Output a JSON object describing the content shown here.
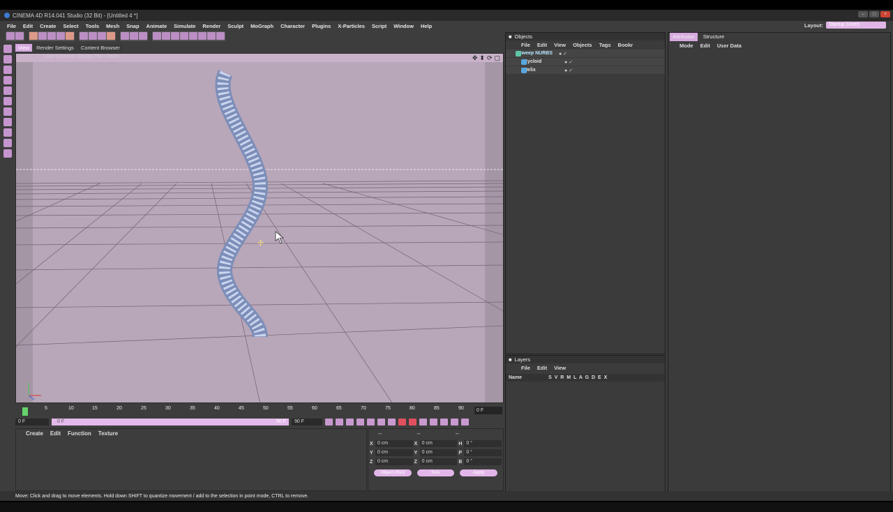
{
  "window": {
    "title": "CINEMA 4D R14.041 Studio (32 Bit) - [Untitled 4 *]"
  },
  "menubar": [
    "File",
    "Edit",
    "Create",
    "Select",
    "Tools",
    "Mesh",
    "Snap",
    "Animate",
    "Simulate",
    "Render",
    "Sculpt",
    "MoGraph",
    "Character",
    "Plugins",
    "X-Particles",
    "Script",
    "Window",
    "Help"
  ],
  "layout": {
    "label": "Layout:",
    "value": "Startup (User)"
  },
  "viewport": {
    "tabs": [
      "View",
      "Render Settings",
      "Content Browser"
    ],
    "menu_hint": "View Cameras Display Filter Panel"
  },
  "timeline": {
    "ticks": [
      "0",
      "5",
      "10",
      "15",
      "20",
      "25",
      "30",
      "35",
      "40",
      "45",
      "50",
      "55",
      "60",
      "65",
      "70",
      "75",
      "80",
      "85",
      "90"
    ],
    "current_frame": "0 F",
    "start_field": "0 F",
    "slider_start": "0 F",
    "slider_end": "90 F",
    "end_field": "90 F"
  },
  "materials": {
    "menu": [
      "Create",
      "Edit",
      "Function",
      "Texture"
    ]
  },
  "coordinates": {
    "headers": [
      "--",
      "--",
      "--"
    ],
    "rows": [
      {
        "a": "X",
        "av": "0 cm",
        "b": "X",
        "bv": "0 cm",
        "c": "H",
        "cv": "0 °"
      },
      {
        "a": "Y",
        "av": "0 cm",
        "b": "Y",
        "bv": "0 cm",
        "c": "P",
        "cv": "0 °"
      },
      {
        "a": "Z",
        "av": "0 cm",
        "b": "Z",
        "bv": "0 cm",
        "c": "B",
        "cv": "0 °"
      }
    ],
    "buttons": [
      "Object (Rel)",
      "Size",
      "Apply"
    ]
  },
  "objects_panel": {
    "title": "Objects",
    "menu": [
      "File",
      "Edit",
      "View",
      "Objects",
      "Tags",
      "Bookr"
    ],
    "items": [
      {
        "name": "Sweep NURBS",
        "color": "#5fc7a8"
      },
      {
        "name": "Cycloid",
        "color": "#58a6e0"
      },
      {
        "name": "Helix",
        "color": "#58a6e0"
      }
    ]
  },
  "layers_panel": {
    "title": "Layers",
    "menu": [
      "File",
      "Edit",
      "View"
    ],
    "header_name": "Name",
    "header_cols": "S V R M L A G D E X"
  },
  "attributes_panel": {
    "tabs": [
      "Attributes",
      "Structure"
    ],
    "menu": [
      "Mode",
      "Edit",
      "User Data"
    ]
  },
  "status": "Move: Click and drag to move elements. Hold down SHIFT to quantize movement / add to the selection in point mode, CTRL to remove."
}
